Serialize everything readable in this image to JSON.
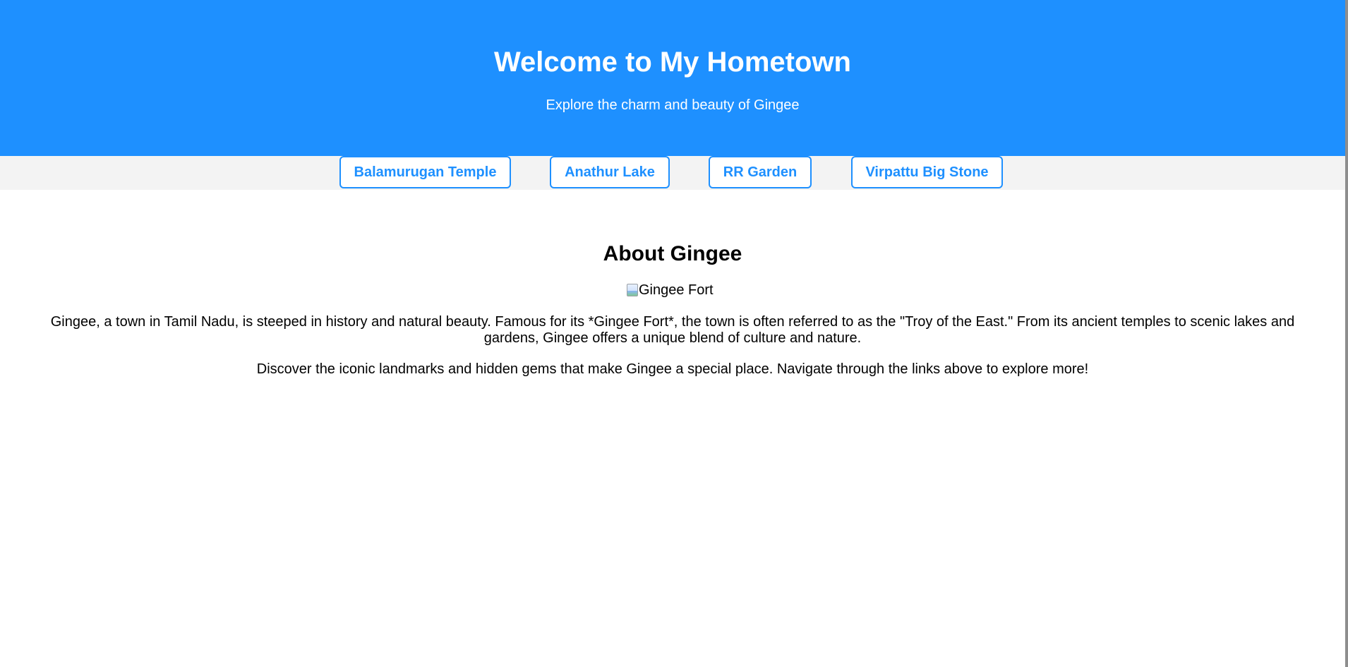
{
  "header": {
    "title": "Welcome to My Hometown",
    "subtitle": "Explore the charm and beauty of Gingee"
  },
  "nav": {
    "items": [
      {
        "label": "Balamurugan Temple"
      },
      {
        "label": "Anathur Lake"
      },
      {
        "label": "RR Garden"
      },
      {
        "label": "Virpattu Big Stone"
      }
    ]
  },
  "main": {
    "heading": "About Gingee",
    "image_alt": "Gingee Fort",
    "paragraph1": "Gingee, a town in Tamil Nadu, is steeped in history and natural beauty. Famous for its *Gingee Fort*, the town is often referred to as the \"Troy of the East.\" From its ancient temples to scenic lakes and gardens, Gingee offers a unique blend of culture and nature.",
    "paragraph2": "Discover the iconic landmarks and hidden gems that make Gingee a special place. Navigate through the links above to explore more!"
  },
  "colors": {
    "accent": "#1e90ff",
    "nav_background": "#f3f3f3",
    "text": "#000000"
  }
}
